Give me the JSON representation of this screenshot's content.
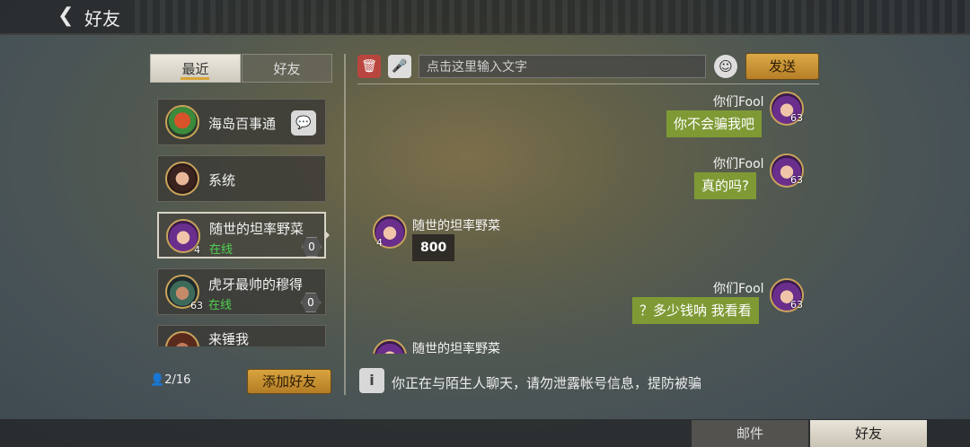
{
  "header": {
    "title": "好友"
  },
  "tabs": {
    "recent": "最近",
    "friends": "好友"
  },
  "friend_list": [
    {
      "name": "海岛百事通",
      "status": "",
      "level": "",
      "unread": "",
      "chat_icon": "speech-bubble-icon"
    },
    {
      "name": "系统",
      "status": "",
      "level": "",
      "unread": ""
    },
    {
      "name": "随世的坦率野菜",
      "status": "在线",
      "level": "4",
      "unread": "0"
    },
    {
      "name": "虎牙最帅的穆得",
      "status": "在线",
      "level": "63",
      "unread": "0"
    },
    {
      "name": "来锤我",
      "status": "",
      "level": "",
      "unread": ""
    }
  ],
  "friend_count": "2/16",
  "add_friend_label": "添加好友",
  "chat": {
    "input_placeholder": "点击这里输入文字",
    "send_label": "发送",
    "messages": [
      {
        "from": "me",
        "sender": "你们Fool",
        "level": "63",
        "text": "你不会骗我吧"
      },
      {
        "from": "me",
        "sender": "你们Fool",
        "level": "63",
        "text": "真的吗?"
      },
      {
        "from": "other",
        "sender": "随世的坦率野菜",
        "level": "4",
        "text": "800"
      },
      {
        "from": "me",
        "sender": "你们Fool",
        "level": "63",
        "text": "？多少钱呐 我看看"
      },
      {
        "from": "other",
        "sender": "随世的坦率野菜",
        "level": "",
        "text": ""
      }
    ],
    "notice": "你正在与陌生人聊天，请勿泄露帐号信息，提防被骗"
  },
  "bottom_tabs": {
    "mail": "邮件",
    "friends": "好友"
  },
  "colors": {
    "accent_gold": "#d6a537",
    "online_green": "#4fd24f",
    "my_bubble": "#7f9a35"
  }
}
